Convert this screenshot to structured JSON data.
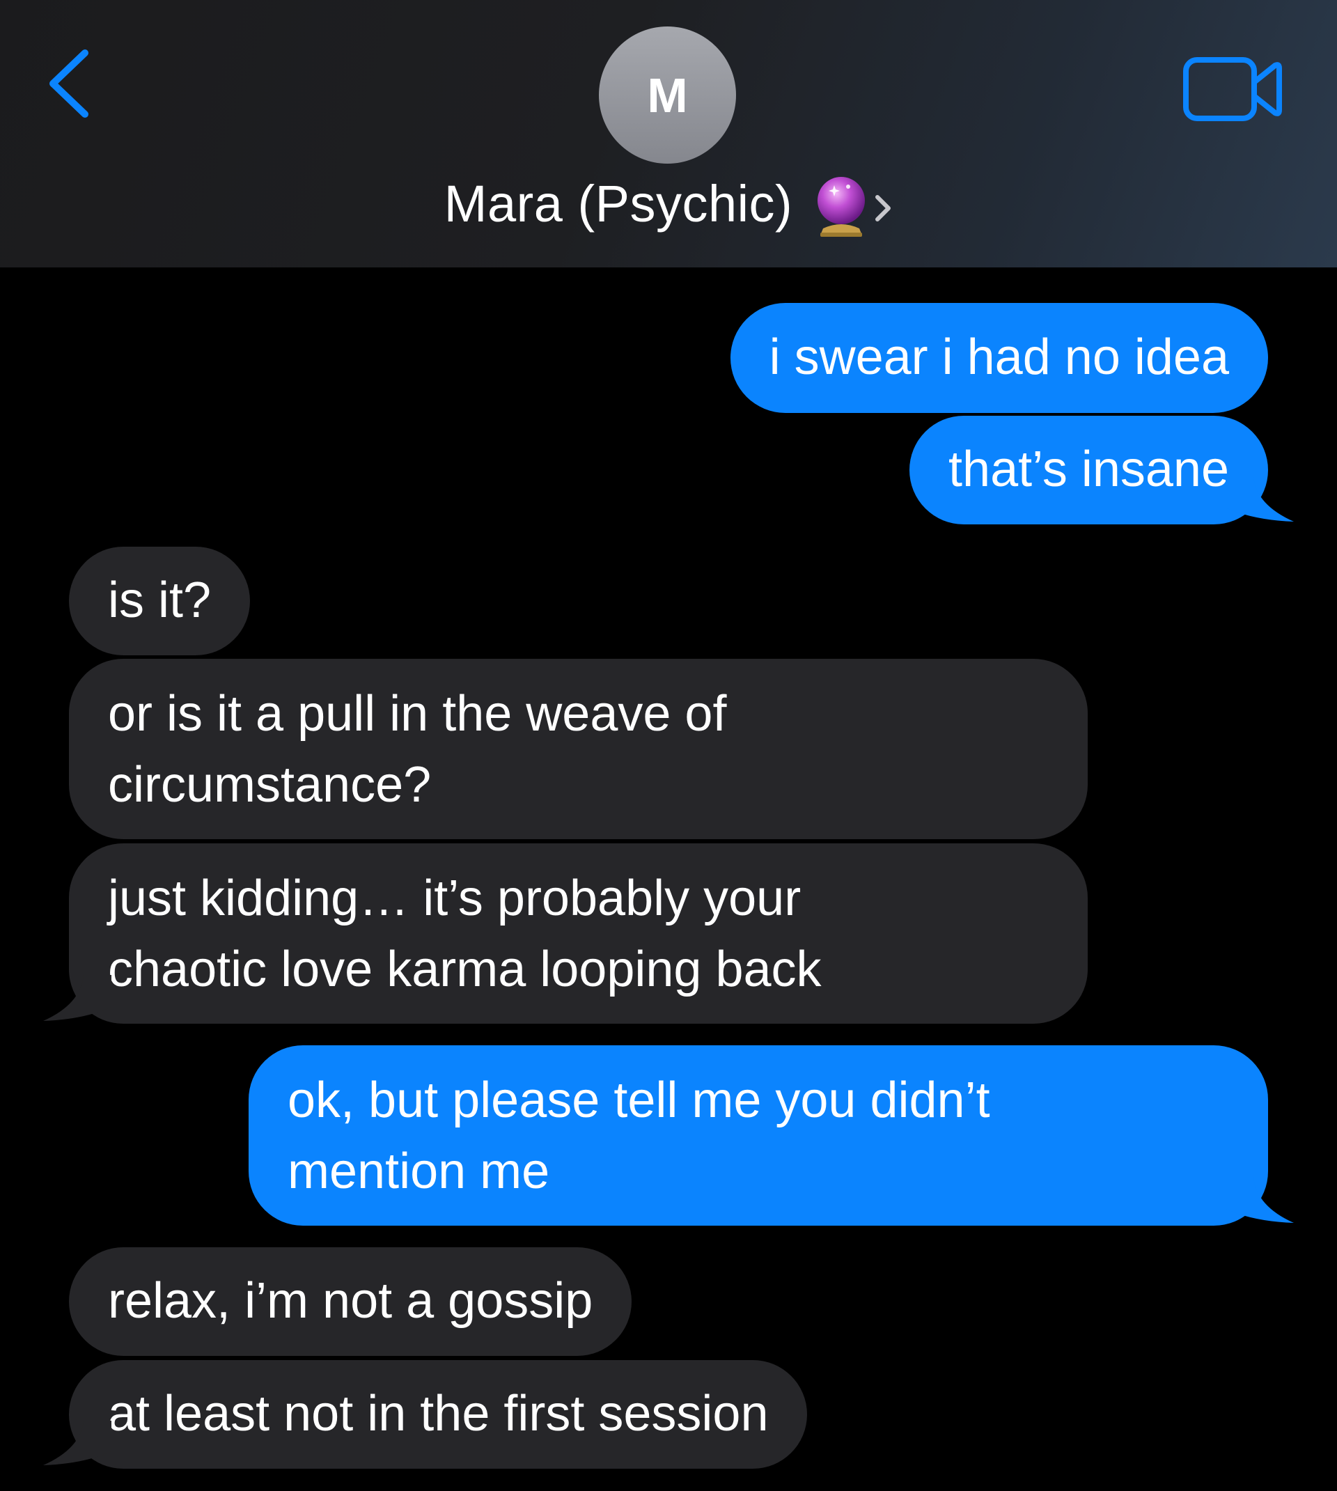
{
  "header": {
    "back_icon": "chevron-left-icon",
    "video_icon": "video-camera-icon",
    "avatar_initial": "M",
    "contact_name": "Mara (Psychic)",
    "contact_emoji": "crystal-ball-icon",
    "contact_chevron": "chevron-right-icon"
  },
  "colors": {
    "accent": "#0b84fe",
    "sent_bubble": "#0b84fe",
    "received_bubble": "#262629",
    "background": "#000000",
    "avatar": "#9a9ca2"
  },
  "messages": [
    {
      "from": "me",
      "text": "i swear i had no idea"
    },
    {
      "from": "me",
      "text": "that’s insane"
    },
    {
      "from": "them",
      "text": "is it?"
    },
    {
      "from": "them",
      "line1": "or is it a pull in the weave of",
      "line2": "circumstance?"
    },
    {
      "from": "them",
      "line1": "just kidding… it’s probably your",
      "line2": "chaotic love karma looping back"
    },
    {
      "from": "me",
      "line1": "ok, but please tell me you didn’t",
      "line2": "mention me"
    },
    {
      "from": "them",
      "text": "relax, i’m not a gossip"
    },
    {
      "from": "them",
      "text": "at least not in the first session"
    }
  ]
}
